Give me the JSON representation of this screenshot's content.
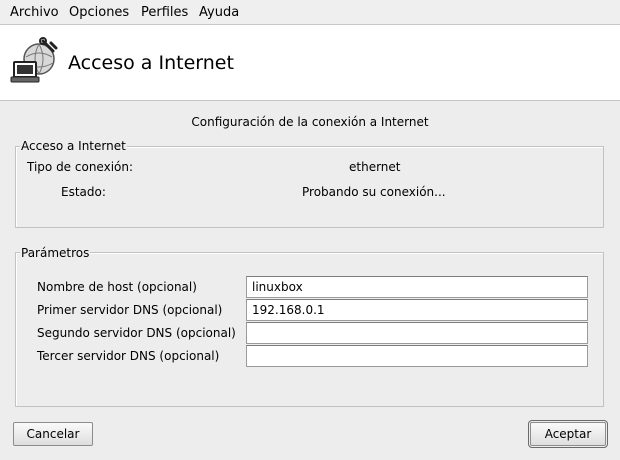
{
  "menubar": {
    "items": [
      {
        "label": "Archivo"
      },
      {
        "label": "Opciones"
      },
      {
        "label": "Perfiles"
      },
      {
        "label": "Ayuda"
      }
    ]
  },
  "header": {
    "title": "Acceso a Internet",
    "icon": "network-computer-wrench-icon"
  },
  "subtitle": "Configuración de la conexión a Internet",
  "internet_group": {
    "legend": "Acceso a Internet",
    "connection_type_label": "Tipo de conexión:",
    "connection_type_value": "ethernet",
    "status_label": "Estado:",
    "status_value": "Probando su conexión..."
  },
  "params_group": {
    "legend": "Parámetros",
    "hostname_label": "Nombre de host (opcional)",
    "hostname_value": "linuxbox",
    "dns1_label": "Primer servidor DNS (opcional)",
    "dns1_value": "192.168.0.1",
    "dns2_label": "Segundo servidor DNS (opcional)",
    "dns2_value": "",
    "dns3_label": "Tercer servidor DNS (opcional)",
    "dns3_value": ""
  },
  "buttons": {
    "cancel": "Cancelar",
    "accept": "Aceptar"
  }
}
